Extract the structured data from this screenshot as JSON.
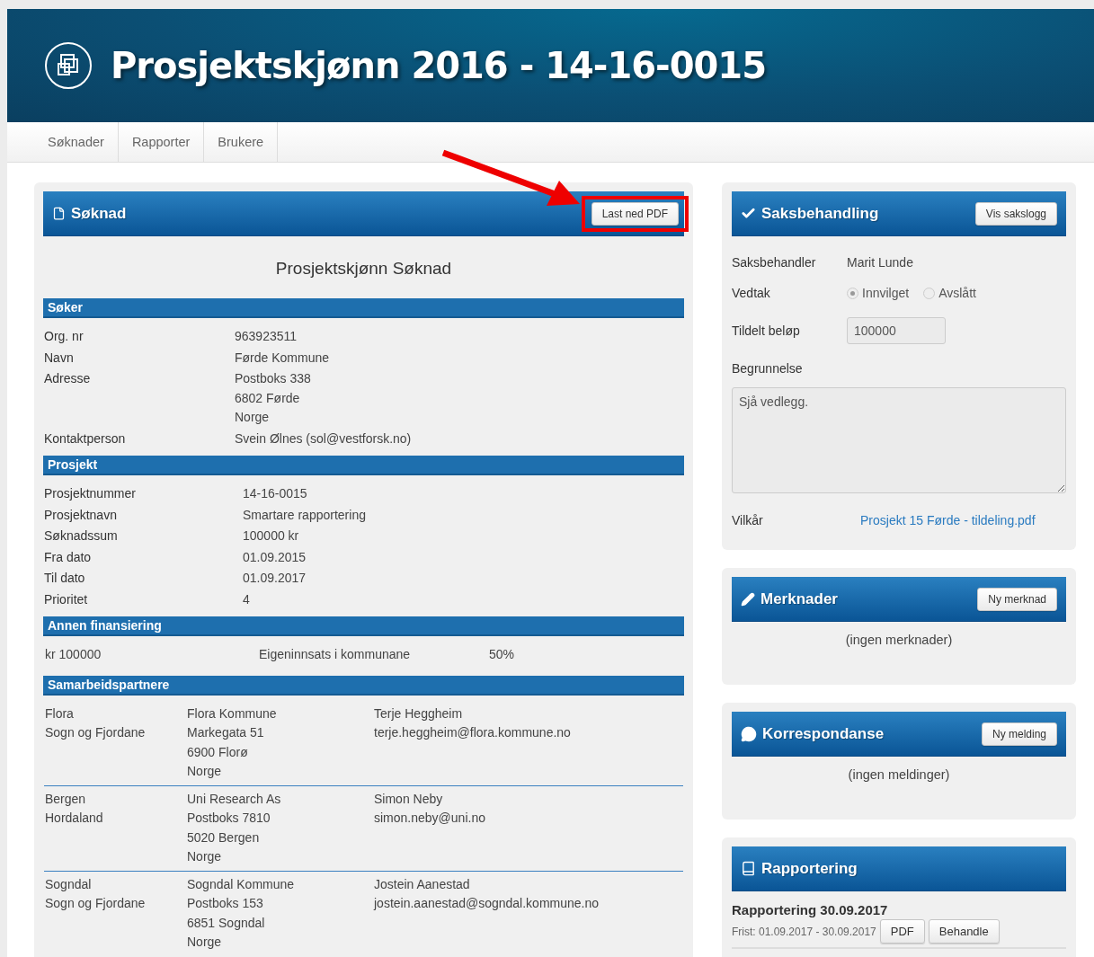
{
  "header": {
    "title": "Prosjektskjønn 2016 - 14-16-0015"
  },
  "nav": [
    {
      "label": "Søknader"
    },
    {
      "label": "Rapporter"
    },
    {
      "label": "Brukere"
    }
  ],
  "application": {
    "panel_title": "Søknad",
    "button": {
      "label": "Last ned PDF",
      "highlighted": true
    },
    "heading": "Prosjektskjønn Søknad",
    "sections": [
      {
        "kind": "fields",
        "title": "Søker",
        "rows": [
          {
            "label": "Org. nr",
            "value": [
              "963923511"
            ]
          },
          {
            "label": "Navn",
            "value": [
              "Førde Kommune"
            ]
          },
          {
            "label": "Adresse",
            "value": [
              "Postboks 338",
              "6802 Førde",
              "Norge"
            ]
          },
          {
            "label": "Kontaktperson",
            "value": [
              "Svein Ølnes (sol@vestforsk.no)"
            ]
          }
        ]
      },
      {
        "kind": "fields",
        "title": "Prosjekt",
        "rows": [
          {
            "label": "Prosjektnummer",
            "value": [
              "14-16-0015"
            ]
          },
          {
            "label": "Prosjektnavn",
            "value": [
              "Smartare rapportering"
            ]
          },
          {
            "label": "Søknadssum",
            "value": [
              "100000 kr"
            ]
          },
          {
            "label": "Fra dato",
            "value": [
              "01.09.2015"
            ]
          },
          {
            "label": "Til dato",
            "value": [
              "01.09.2017"
            ]
          },
          {
            "label": "Prioritet",
            "value": [
              "4"
            ]
          }
        ]
      },
      {
        "kind": "financing",
        "title": "Annen finansiering",
        "rows": [
          {
            "cells": [
              [
                "kr 100000"
              ],
              [
                "Eigeninnsats i kommunane"
              ],
              [
                "50%"
              ]
            ]
          }
        ]
      },
      {
        "kind": "partners",
        "title": "Samarbeidspartnere",
        "rows": [
          {
            "cells": [
              [
                "Flora",
                "Sogn og Fjordane"
              ],
              [
                "Flora Kommune",
                "Markegata 51",
                "6900 Florø",
                "Norge"
              ],
              [
                "Terje Heggheim",
                "terje.heggheim@flora.kommune.no"
              ]
            ]
          },
          {
            "cells": [
              [
                "Bergen",
                "Hordaland"
              ],
              [
                "Uni Research As",
                "Postboks 7810",
                "5020 Bergen",
                "Norge"
              ],
              [
                "Simon Neby",
                "simon.neby@uni.no"
              ]
            ]
          },
          {
            "cells": [
              [
                "Sogndal",
                "Sogn og Fjordane"
              ],
              [
                "Sogndal Kommune",
                "Postboks 153",
                "6851 Sogndal",
                "Norge"
              ],
              [
                "Jostein Aanestad",
                "jostein.aanestad@sogndal.kommune.no"
              ]
            ]
          }
        ]
      }
    ]
  },
  "case": {
    "title": "Saksbehandling",
    "button": "Vis sakslogg",
    "handler_label": "Saksbehandler",
    "handler": "Marit Lunde",
    "decision_label": "Vedtak",
    "options": [
      {
        "label": "Innvilget",
        "selected": true
      },
      {
        "label": "Avslått",
        "selected": false
      }
    ],
    "amount_label": "Tildelt beløp",
    "amount": "100000",
    "reason_label": "Begrunnelse",
    "reason": "Sjå vedlegg.",
    "terms_label": "Vilkår",
    "terms_link": "Prosjekt 15 Førde - tildeling.pdf"
  },
  "remarks": {
    "title": "Merknader",
    "button": "Ny merknad",
    "empty": "(ingen merknader)"
  },
  "correspondence": {
    "title": "Korrespondanse",
    "button": "Ny melding",
    "empty": "(ingen meldinger)"
  },
  "reporting": {
    "title": "Rapportering",
    "items": [
      {
        "title": "Rapportering 30.09.2017",
        "deadline": "Frist: 01.09.2017 - 30.09.2017",
        "buttons": [
          "PDF",
          "Behandle"
        ]
      }
    ]
  }
}
